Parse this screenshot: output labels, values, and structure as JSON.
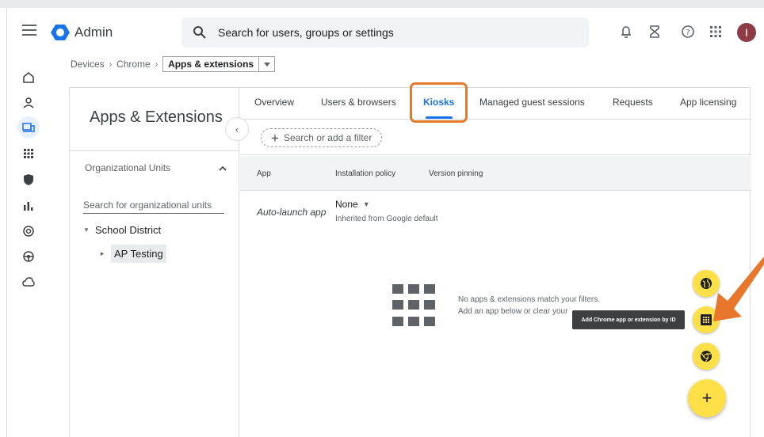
{
  "topbar": {
    "app_title": "Admin",
    "search_placeholder": "Search for users, groups or settings",
    "avatar_letter": "I",
    "icons": [
      "notifications-icon",
      "hourglass-icon",
      "help-icon",
      "apps-grid-icon"
    ]
  },
  "rail": {
    "items": [
      "home-icon",
      "users-icon",
      "devices-icon",
      "apps-icon",
      "security-icon",
      "reporting-icon",
      "account-icon",
      "rules-icon",
      "storage-icon"
    ],
    "active": "devices-icon"
  },
  "breadcrumb": {
    "items": [
      "Devices",
      "Chrome"
    ],
    "current": "Apps & extensions"
  },
  "left_pane": {
    "title": "Apps & Extensions",
    "org_units_label": "Organizational Units",
    "search_placeholder": "Search for organizational units",
    "tree": [
      {
        "label": "School District",
        "expanded": true
      },
      {
        "label": "AP Testing",
        "selected": true
      }
    ]
  },
  "tabs": [
    {
      "label": "Overview"
    },
    {
      "label": "Users & browsers"
    },
    {
      "label": "Kiosks",
      "active": true
    },
    {
      "label": "Managed guest sessions"
    },
    {
      "label": "Requests"
    },
    {
      "label": "App licensing"
    }
  ],
  "filter": {
    "label": "Search or add a filter"
  },
  "table": {
    "columns": [
      "App",
      "Installation policy",
      "Version pinning"
    ],
    "row": {
      "app": "Auto-launch app",
      "policy": "None",
      "inherited": "Inherited from Google default"
    }
  },
  "empty_state": {
    "line1": "No apps & extensions match your filters.",
    "line2": "Add an app below or clear your"
  },
  "tooltip": "Add Chrome app or extension by ID",
  "fab": {
    "main_label": "+",
    "mini": [
      "web-icon",
      "app-id-icon",
      "chrome-icon"
    ]
  },
  "colors": {
    "accent": "#1a73e8",
    "highlight": "#e07a2e",
    "fab": "#fde047"
  }
}
